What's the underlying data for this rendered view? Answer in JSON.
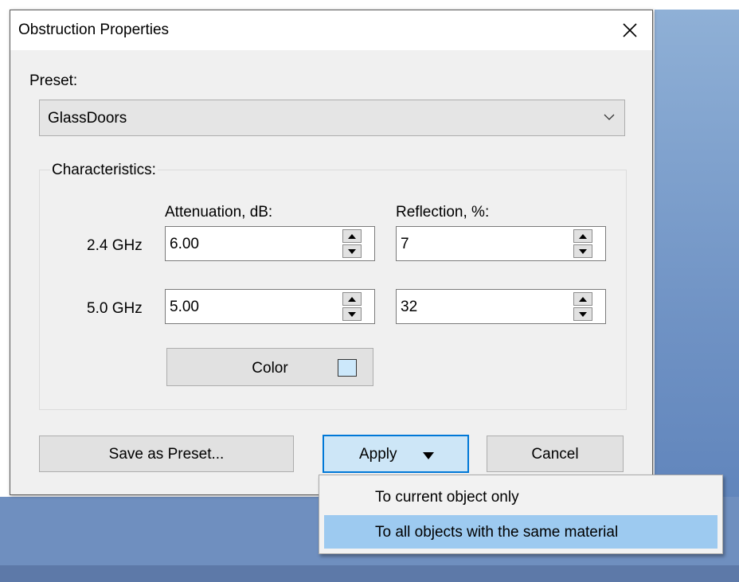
{
  "dialog": {
    "title": "Obstruction Properties",
    "close_icon": "close-icon"
  },
  "preset": {
    "label": "Preset:",
    "value": "GlassDoors",
    "dropdown_icon": "chevron-down-icon"
  },
  "characteristics": {
    "group_title": "Characteristics:",
    "attenuation_header": "Attenuation, dB:",
    "reflection_header": "Reflection, %:",
    "rows": [
      {
        "band": "2.4 GHz",
        "attenuation": "6.00",
        "reflection": "7"
      },
      {
        "band": "5.0 GHz",
        "attenuation": "5.00",
        "reflection": "32"
      }
    ],
    "color_label": "Color",
    "color_value": "#cce8fb"
  },
  "buttons": {
    "save_preset": "Save as Preset...",
    "apply": "Apply",
    "apply_icon": "triangle-down-icon",
    "cancel": "Cancel"
  },
  "apply_menu": {
    "items": [
      {
        "label": "To current object only",
        "highlighted": false
      },
      {
        "label": "To all objects with the same material",
        "highlighted": true
      }
    ]
  },
  "colors": {
    "accent": "#0078d7",
    "menu_highlight": "#9dcaf0",
    "dialog_bg": "#f0f0f0"
  }
}
